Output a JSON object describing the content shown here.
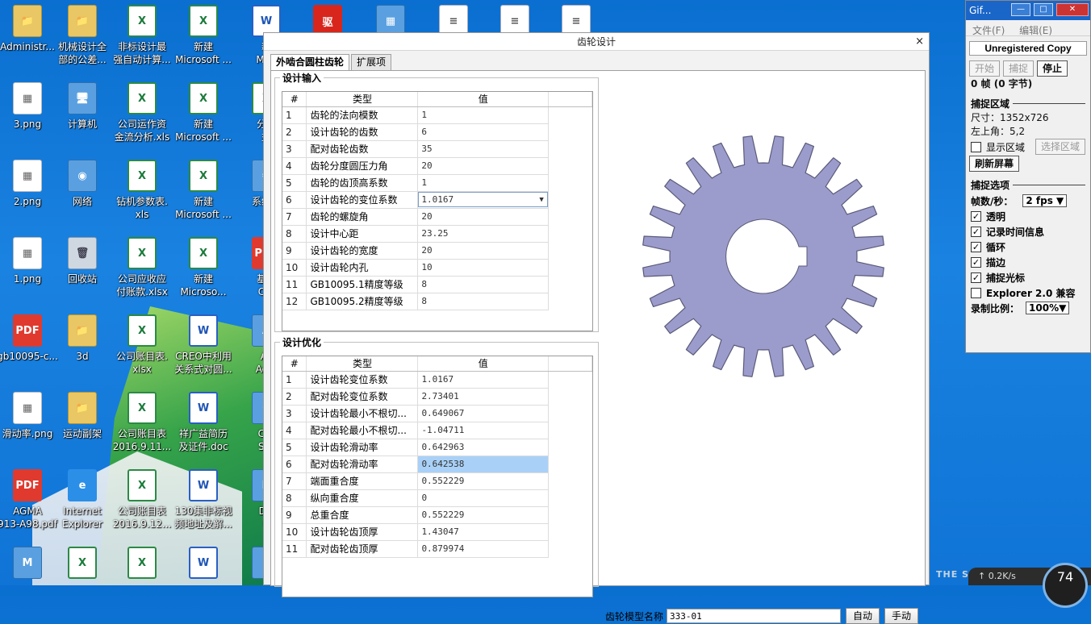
{
  "desktop": {
    "col1": [
      {
        "label": "Administr...",
        "type": "folder",
        "glyph": "📁"
      },
      {
        "label": "3.png",
        "type": "img",
        "glyph": "▦"
      },
      {
        "label": "2.png",
        "type": "img",
        "glyph": "▦"
      },
      {
        "label": "1.png",
        "type": "img",
        "glyph": "▦"
      },
      {
        "label": "gb10095-c...",
        "type": "pdf",
        "glyph": "PDF"
      },
      {
        "label": "滑动率.png",
        "type": "img",
        "glyph": "▦"
      },
      {
        "label": "AGMA\n913-A98.pdf",
        "type": "pdf",
        "glyph": "PDF"
      },
      {
        "label": "",
        "type": "sys",
        "glyph": "M"
      }
    ],
    "col2": [
      {
        "label": "机械设计全\n部的公差...",
        "type": "folder",
        "glyph": "📁"
      },
      {
        "label": "计算机",
        "type": "sys",
        "glyph": "🖥"
      },
      {
        "label": "网络",
        "type": "sys",
        "glyph": "◉"
      },
      {
        "label": "回收站",
        "type": "trash",
        "glyph": "🗑"
      },
      {
        "label": "3d",
        "type": "folder",
        "glyph": "📁"
      },
      {
        "label": "运动副架",
        "type": "folder",
        "glyph": "📁"
      },
      {
        "label": "Internet\nExplorer",
        "type": "ie",
        "glyph": "e"
      },
      {
        "label": "",
        "type": "xls",
        "glyph": "X"
      }
    ],
    "col3": [
      {
        "label": "非标设计最\n强自动计算...",
        "type": "xls",
        "glyph": "X"
      },
      {
        "label": "公司运作资\n金流分析.xls",
        "type": "xls",
        "glyph": "X"
      },
      {
        "label": "钻机参数表.\nxls",
        "type": "xls",
        "glyph": "X"
      },
      {
        "label": "公司应收应\n付账款.xlsx",
        "type": "xls",
        "glyph": "X"
      },
      {
        "label": "公司账目表.\nxlsx",
        "type": "xls",
        "glyph": "X"
      },
      {
        "label": "公司账目表\n2016.9.11...",
        "type": "xls",
        "glyph": "X"
      },
      {
        "label": "公司账目表\n2016.9.12...",
        "type": "xls",
        "glyph": "X"
      },
      {
        "label": "",
        "type": "xls",
        "glyph": "X"
      }
    ],
    "col4": [
      {
        "label": "新建\nMicrosoft ...",
        "type": "xls",
        "glyph": "X"
      },
      {
        "label": "新建\nMicrosoft ...",
        "type": "xls",
        "glyph": "X"
      },
      {
        "label": "新建\nMicrosoft ...",
        "type": "xls",
        "glyph": "X"
      },
      {
        "label": "新建\nMicroso...",
        "type": "xls",
        "glyph": "X"
      },
      {
        "label": "CREO中利用\n关系式对圆...",
        "type": "doc",
        "glyph": "W"
      },
      {
        "label": "祥广益简历\n及证件.doc",
        "type": "doc",
        "glyph": "W"
      },
      {
        "label": "130集非标视\n频地址及解...",
        "type": "doc",
        "glyph": "W"
      },
      {
        "label": "",
        "type": "doc",
        "glyph": "W"
      }
    ],
    "col5": [
      {
        "label": "新\nMicr",
        "type": "doc",
        "glyph": "W"
      },
      {
        "label": "分组\n益",
        "type": "xls",
        "glyph": "X"
      },
      {
        "label": "系统流",
        "type": "sys",
        "glyph": "⚙"
      },
      {
        "label": "基于\nCre",
        "type": "pdf",
        "glyph": "PDF"
      },
      {
        "label": "Ac\nAcro",
        "type": "sys",
        "glyph": "A"
      },
      {
        "label": "Car\nStu",
        "type": "sys",
        "glyph": "C"
      },
      {
        "label": "DO\n0",
        "type": "sys",
        "glyph": "D"
      },
      {
        "label": "",
        "type": "sys",
        "glyph": ""
      }
    ],
    "top_extra": [
      {
        "label": "",
        "type": "red",
        "glyph": "驱"
      },
      {
        "label": "",
        "type": "sys",
        "glyph": "▦"
      },
      {
        "label": "",
        "type": "txt",
        "glyph": "≡"
      },
      {
        "label": "",
        "type": "txt",
        "glyph": "≡"
      },
      {
        "label": "",
        "type": "txt",
        "glyph": "≡"
      }
    ]
  },
  "dialog": {
    "title": "齿轮设计",
    "close": "×",
    "tabs": [
      "外啮合圆柱齿轮",
      "扩展项"
    ],
    "input_group": {
      "legend": "设计输入",
      "headers": [
        "#",
        "类型",
        "值"
      ],
      "rows": [
        {
          "n": "1",
          "type": "齿轮的法向模数",
          "value": "1"
        },
        {
          "n": "2",
          "type": "设计齿轮的齿数",
          "value": "6"
        },
        {
          "n": "3",
          "type": "配对齿轮齿数",
          "value": "35"
        },
        {
          "n": "4",
          "type": "齿轮分度圆压力角",
          "value": "20"
        },
        {
          "n": "5",
          "type": "齿轮的齿顶高系数",
          "value": "1"
        },
        {
          "n": "6",
          "type": "设计齿轮的变位系数",
          "value": "1.0167",
          "editing": true
        },
        {
          "n": "7",
          "type": "齿轮的螺旋角",
          "value": "20"
        },
        {
          "n": "8",
          "type": "设计中心距",
          "value": "23.25"
        },
        {
          "n": "9",
          "type": "设计齿轮的宽度",
          "value": "20"
        },
        {
          "n": "10",
          "type": "设计齿轮内孔",
          "value": "10"
        },
        {
          "n": "11",
          "type": "GB10095.1精度等级",
          "value": "8"
        },
        {
          "n": "12",
          "type": "GB10095.2精度等级",
          "value": "8"
        }
      ]
    },
    "opt_group": {
      "legend": "设计优化",
      "headers": [
        "#",
        "类型",
        "值"
      ],
      "rows": [
        {
          "n": "1",
          "type": "设计齿轮变位系数",
          "value": "1.0167"
        },
        {
          "n": "2",
          "type": "配对齿轮变位系数",
          "value": "2.73401"
        },
        {
          "n": "3",
          "type": "设计齿轮最小不根切...",
          "value": "0.649067"
        },
        {
          "n": "4",
          "type": "配对齿轮最小不根切...",
          "value": "-1.04711"
        },
        {
          "n": "5",
          "type": "设计齿轮滑动率",
          "value": "0.642963"
        },
        {
          "n": "6",
          "type": "配对齿轮滑动率",
          "value": "0.642538",
          "selected": true
        },
        {
          "n": "7",
          "type": "端面重合度",
          "value": "0.552229"
        },
        {
          "n": "8",
          "type": "纵向重合度",
          "value": "0"
        },
        {
          "n": "9",
          "type": "总重合度",
          "value": "0.552229"
        },
        {
          "n": "10",
          "type": "设计齿轮齿顶厚",
          "value": "1.43047"
        },
        {
          "n": "11",
          "type": "配对齿轮齿顶厚",
          "value": "0.879974"
        }
      ]
    },
    "gear": {
      "teeth": 24,
      "fill": "#9b9ccb",
      "stroke": "#5a5a7a"
    },
    "model_label": "齿轮模型名称",
    "model_value": "333-01",
    "auto_btn": "自动",
    "manual_btn": "手动"
  },
  "gifcam": {
    "title": "Gif...",
    "menu": [
      "文件(F)",
      "编辑(E)"
    ],
    "registration": "Unregistered Copy",
    "buttons": [
      "开始",
      "捕捉",
      "停止"
    ],
    "frames": "0 帧 (0 字节)",
    "capture_area_title": "捕捉区域",
    "size": "尺寸：1352x726",
    "top_left": "左上角：5,2",
    "show_area": "显示区域",
    "select_area": "选择区域",
    "refresh": "刷新屏幕",
    "capture_options_title": "捕捉选项",
    "fps_label": "帧数/秒：",
    "fps_value": "2 fps ▼",
    "options": [
      {
        "label": "透明",
        "checked": true
      },
      {
        "label": "记录时间信息",
        "checked": true
      },
      {
        "label": "循环",
        "checked": true
      },
      {
        "label": "描边",
        "checked": true
      },
      {
        "label": "捕捉光标",
        "checked": true
      },
      {
        "label": "Explorer 2.0 兼容",
        "checked": false
      }
    ],
    "scale_label": "录制比例：",
    "scale_value": "100%▼"
  },
  "taskbar_widget": {
    "speed": "↑ 0.2K/s",
    "dial": "74",
    "watermark": "THE S"
  }
}
